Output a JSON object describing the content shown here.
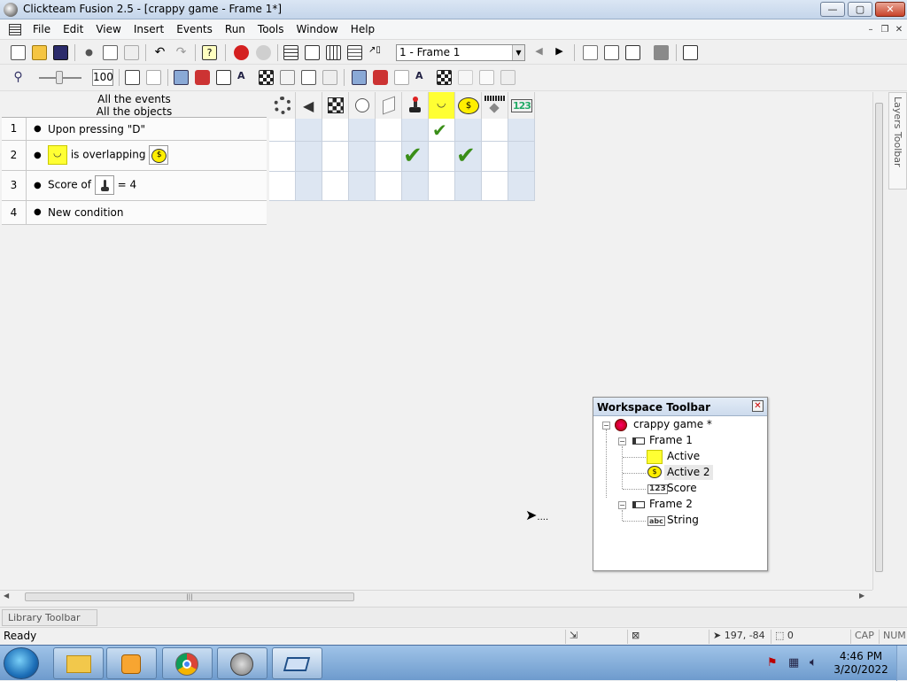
{
  "window": {
    "title": "Clickteam Fusion 2.5 - [crappy game - Frame 1*]",
    "min": "—",
    "max": "▢",
    "close": "✕"
  },
  "mdi": {
    "min": "–",
    "restore": "❐",
    "close": "✕"
  },
  "menu": [
    "File",
    "Edit",
    "View",
    "Insert",
    "Events",
    "Run",
    "Tools",
    "Window",
    "Help"
  ],
  "toolbar": {
    "frame_selector": "1 - Frame 1",
    "zoom_value": "100"
  },
  "events": {
    "header_line1": "All the events",
    "header_line2": "All the objects",
    "rows": [
      {
        "num": "1",
        "text": "Upon pressing \"D\""
      },
      {
        "num": "2",
        "text": "is overlapping"
      },
      {
        "num": "3",
        "text_before": "Score of",
        "text_after": "= 4"
      },
      {
        "num": "4",
        "text": "New condition"
      }
    ]
  },
  "grid": {
    "score_header": "123",
    "checkmark": "✔"
  },
  "layers_toolbar": "Layers Toolbar",
  "library_toolbar": "Library Toolbar",
  "status": {
    "ready": "Ready",
    "coords": "197, -84",
    "count": "0",
    "cap": "CAP",
    "num": "NUM"
  },
  "workspace": {
    "title": "Workspace Toolbar",
    "app": "crappy game *",
    "frame1": "Frame 1",
    "active": "Active",
    "active2": "Active 2",
    "score": "Score",
    "frame2": "Frame 2",
    "string": "String",
    "score_icon": "123",
    "string_icon": "abc"
  },
  "clock": {
    "time": "4:46 PM",
    "date": "3/20/2022"
  },
  "cursor_trail": "....",
  "colors": {
    "yellow": "#ffff33",
    "check": "#3a8e18",
    "taskbar": "#6e9bcd"
  }
}
